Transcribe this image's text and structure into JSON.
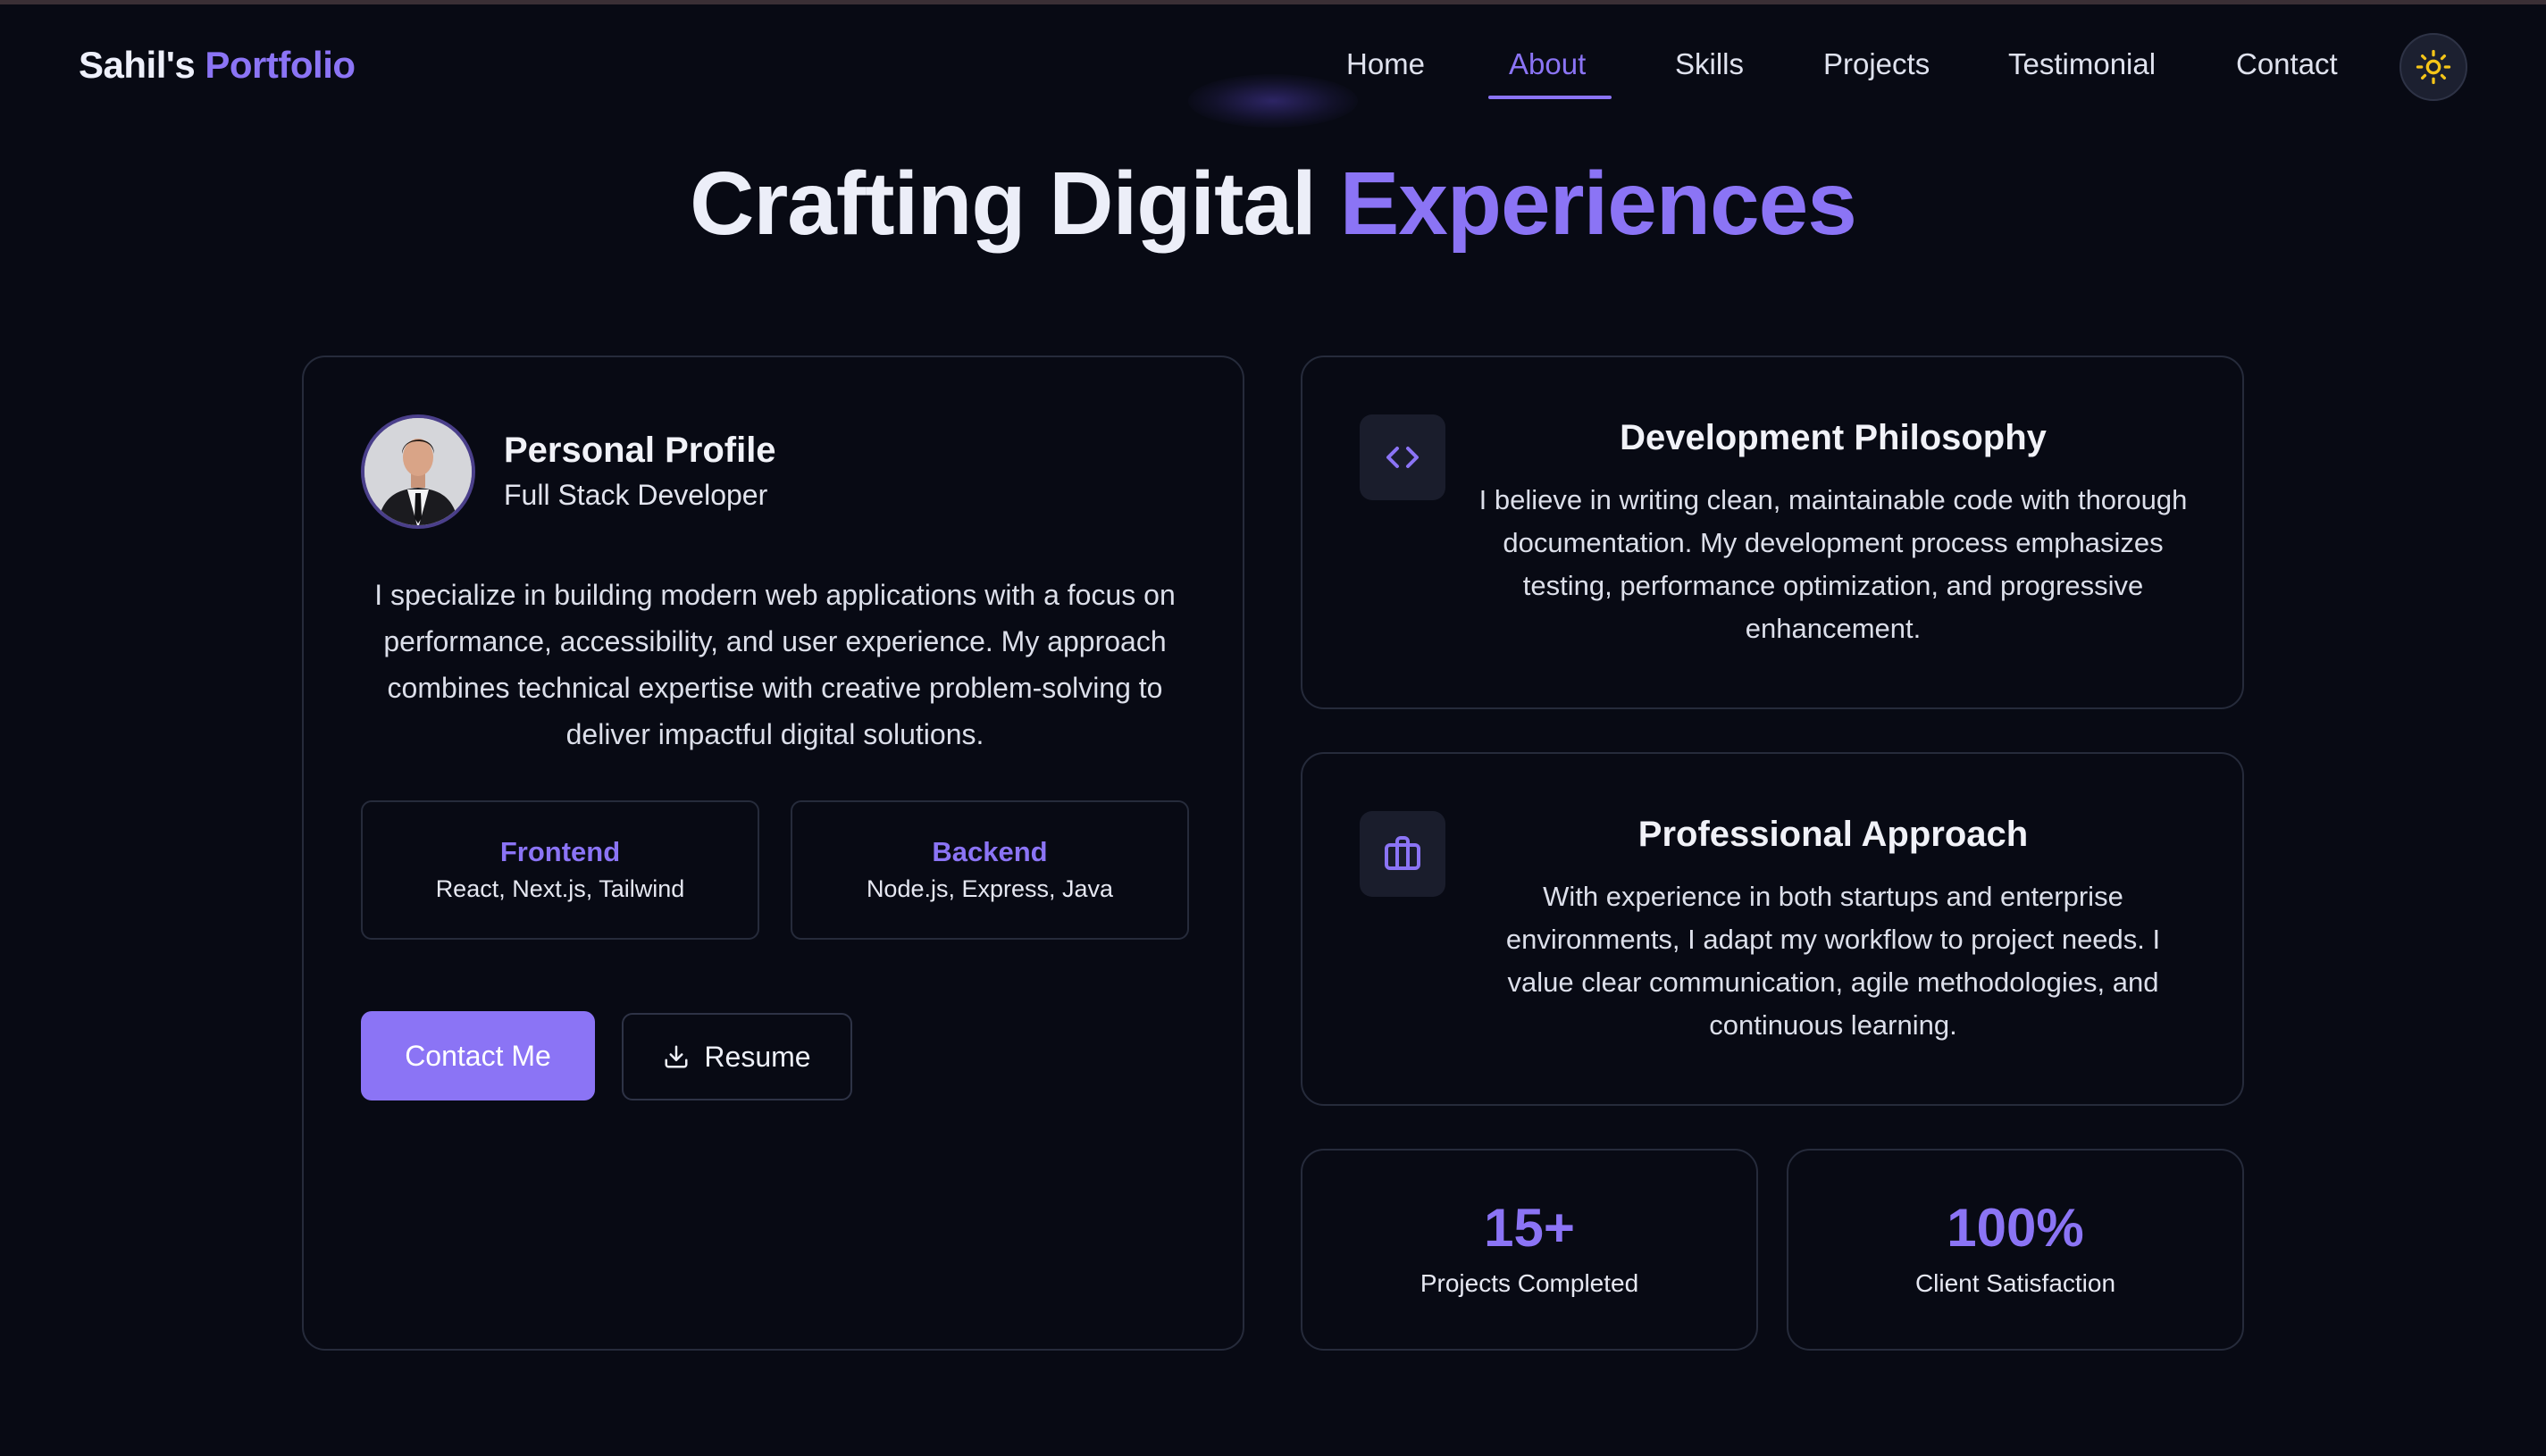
{
  "brand": {
    "first": "Sahil's",
    "second": "Portfolio"
  },
  "nav": {
    "items": [
      "Home",
      "About",
      "Skills",
      "Projects",
      "Testimonial",
      "Contact"
    ],
    "active": "About",
    "theme_toggle_icon": "sun-icon"
  },
  "hero": {
    "title_plain": "Crafting Digital",
    "title_accent": "Experiences"
  },
  "profile": {
    "title": "Personal Profile",
    "subtitle": "Full Stack Developer",
    "description": "I specialize in building modern web applications with a focus on performance, accessibility, and user experience. My approach combines technical expertise with creative problem-solving to deliver impactful digital solutions.",
    "skills": [
      {
        "title": "Frontend",
        "detail": "React, Next.js, Tailwind"
      },
      {
        "title": "Backend",
        "detail": "Node.js, Express, Java"
      }
    ],
    "contact_label": "Contact Me",
    "resume_label": "Resume"
  },
  "philosophy": {
    "icon": "code-icon",
    "title": "Development Philosophy",
    "description": "I believe in writing clean, maintainable code with thorough documentation. My development process emphasizes testing, performance optimization, and progressive enhancement."
  },
  "approach": {
    "icon": "briefcase-icon",
    "title": "Professional Approach",
    "description": "With experience in both startups and enterprise environments, I adapt my workflow to project needs. I value clear communication, agile methodologies, and continuous learning."
  },
  "stats": [
    {
      "value": "15+",
      "label": "Projects Completed"
    },
    {
      "value": "100%",
      "label": "Client Satisfaction"
    }
  ],
  "colors": {
    "accent": "#8b74f5",
    "background": "#080a14",
    "border": "#262b3b",
    "sun": "#f5c518"
  }
}
